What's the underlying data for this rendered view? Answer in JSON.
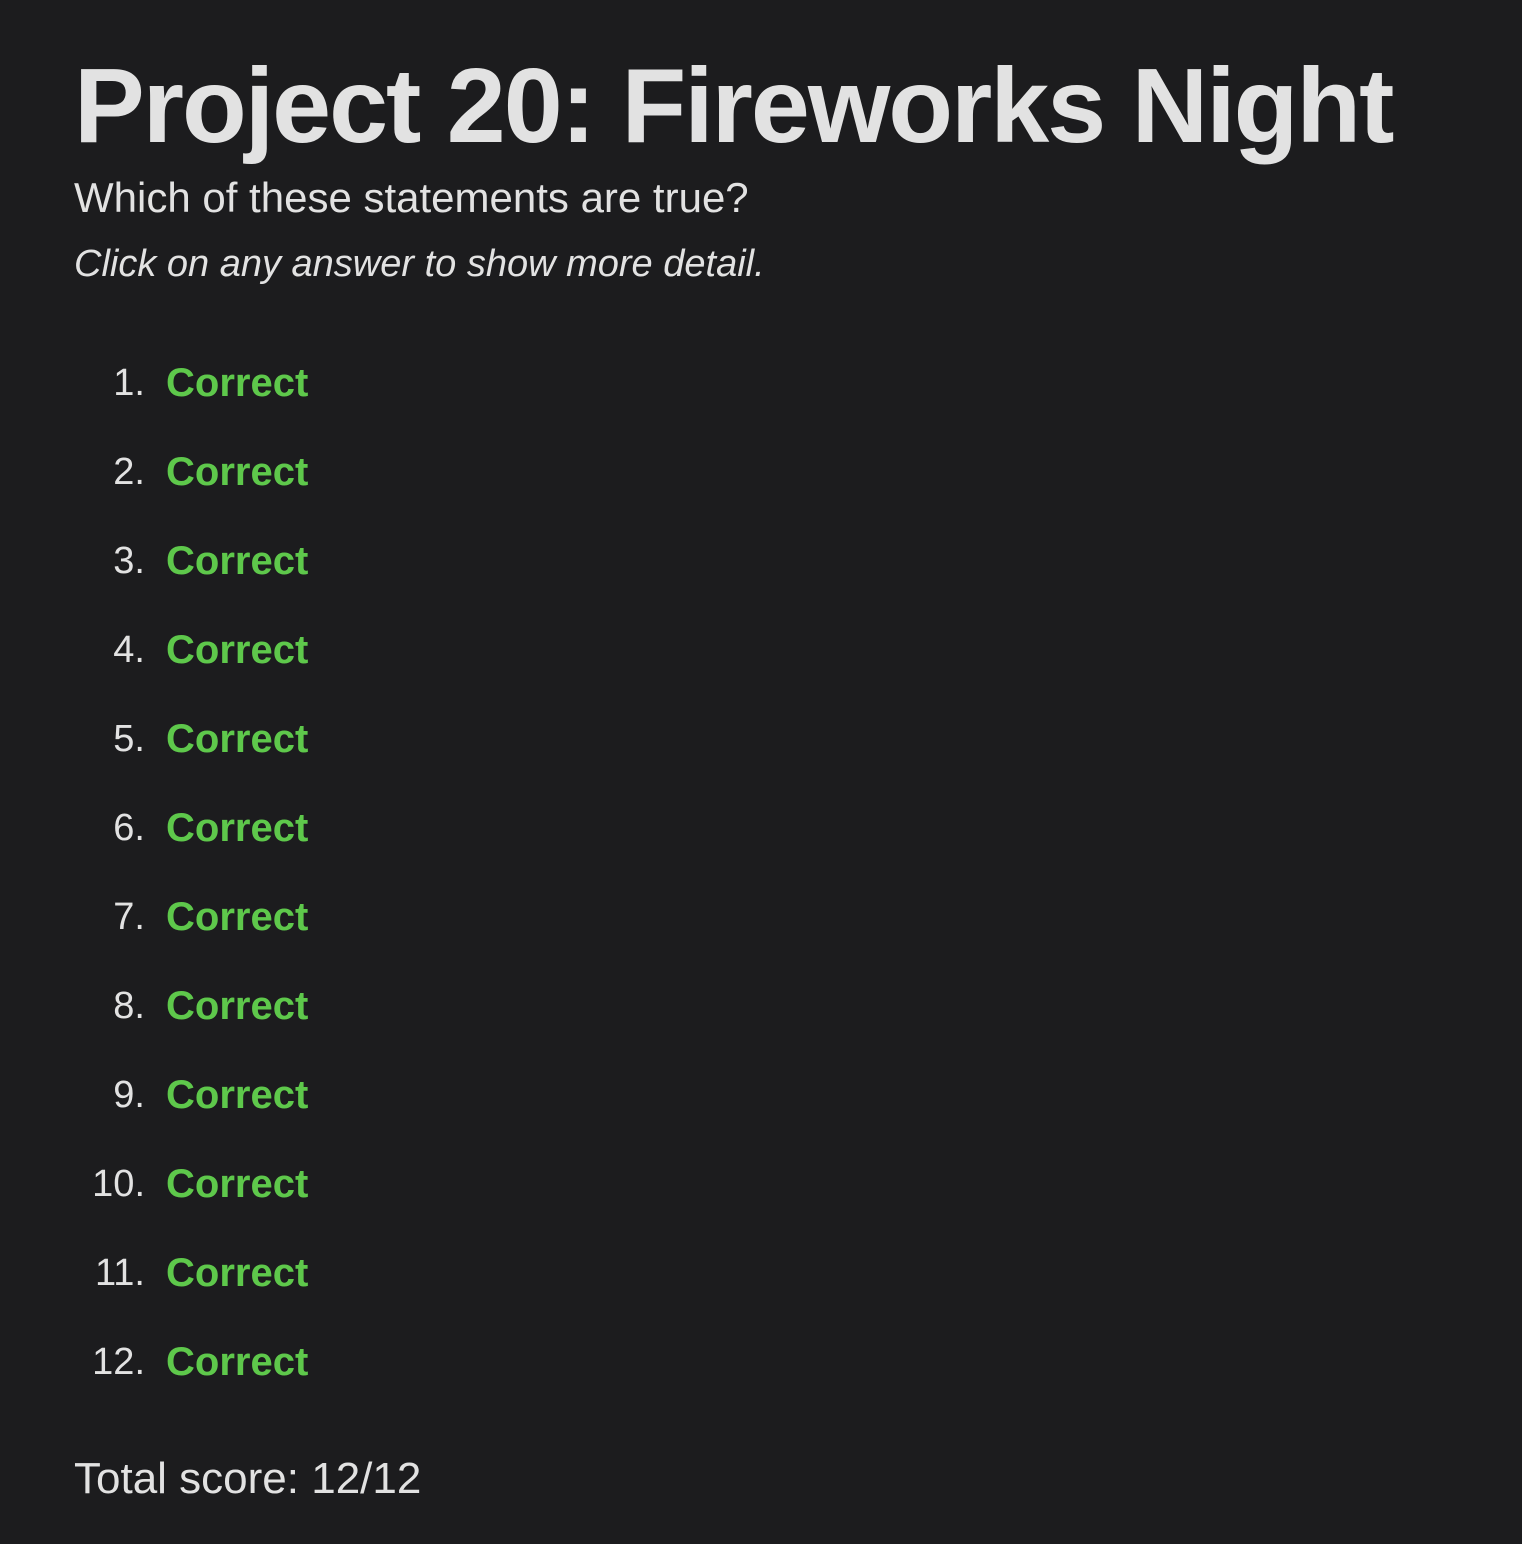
{
  "page": {
    "title": "Project 20: Fireworks Night",
    "question": "Which of these statements are true?",
    "hint": "Click on any answer to show more detail."
  },
  "colors": {
    "background": "#1c1c1e",
    "text": "#e2e2e2",
    "correct": "#5ec84b"
  },
  "answers": [
    {
      "number": "1.",
      "label": "Correct"
    },
    {
      "number": "2.",
      "label": "Correct"
    },
    {
      "number": "3.",
      "label": "Correct"
    },
    {
      "number": "4.",
      "label": "Correct"
    },
    {
      "number": "5.",
      "label": "Correct"
    },
    {
      "number": "6.",
      "label": "Correct"
    },
    {
      "number": "7.",
      "label": "Correct"
    },
    {
      "number": "8.",
      "label": "Correct"
    },
    {
      "number": "9.",
      "label": "Correct"
    },
    {
      "number": "10.",
      "label": "Correct"
    },
    {
      "number": "11.",
      "label": "Correct"
    },
    {
      "number": "12.",
      "label": "Correct"
    }
  ],
  "score": {
    "label": "Total score:",
    "value": "12/12"
  }
}
